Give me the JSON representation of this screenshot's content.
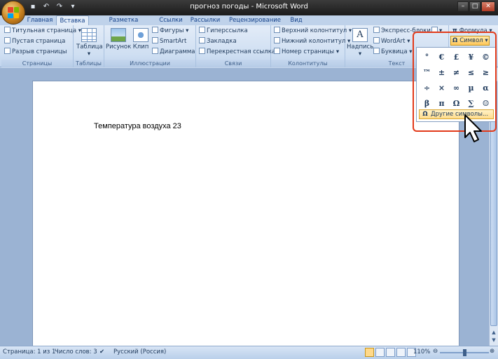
{
  "window": {
    "title": "прогноз погоды - Microsoft Word",
    "qat": [
      "save-icon",
      "undo-icon",
      "redo-icon",
      "customize-icon"
    ],
    "controls": [
      "minimize-icon",
      "maximize-icon",
      "close-icon"
    ]
  },
  "tabs": [
    "Главная",
    "Вставка",
    "Разметка страницы",
    "Ссылки",
    "Рассылки",
    "Рецензирование",
    "Вид"
  ],
  "active_tab": "Вставка",
  "ribbon": {
    "pages": {
      "label": "Страницы",
      "items": [
        "Титульная страница",
        "Пустая страница",
        "Разрыв страницы"
      ]
    },
    "tables": {
      "label": "Таблицы",
      "table": "Таблица"
    },
    "illustrations": {
      "label": "Иллюстрации",
      "picture": "Рисунок",
      "clip": "Клип",
      "items": [
        "Фигуры",
        "SmartArt",
        "Диаграмма"
      ]
    },
    "links": {
      "label": "Связи",
      "items": [
        "Гиперссылка",
        "Закладка",
        "Перекрестная ссылка"
      ]
    },
    "headers": {
      "label": "Колонтитулы",
      "items": [
        "Верхний колонтитул",
        "Нижний колонтитул",
        "Номер страницы"
      ]
    },
    "text": {
      "label": "Текст",
      "textbox": "Надпись",
      "items": [
        "Экспресс-блоки",
        "WordArt",
        "Буквица"
      ]
    },
    "symbols": {
      "formula": "Формула",
      "symbol": "Символ"
    }
  },
  "symbol_dropdown": {
    "symbols": [
      "°",
      "€",
      "£",
      "¥",
      "©",
      "™",
      "±",
      "≠",
      "≤",
      "≥",
      "÷",
      "×",
      "∞",
      "µ",
      "α",
      "β",
      "π",
      "Ω",
      "∑",
      "☺"
    ],
    "more": "Другие символы..."
  },
  "document": {
    "text": "Температура воздуха 23"
  },
  "status": {
    "page": "Страница: 1 из 1",
    "words": "Число слов: 3",
    "language": "Русский (Россия)",
    "zoom": "110%"
  }
}
